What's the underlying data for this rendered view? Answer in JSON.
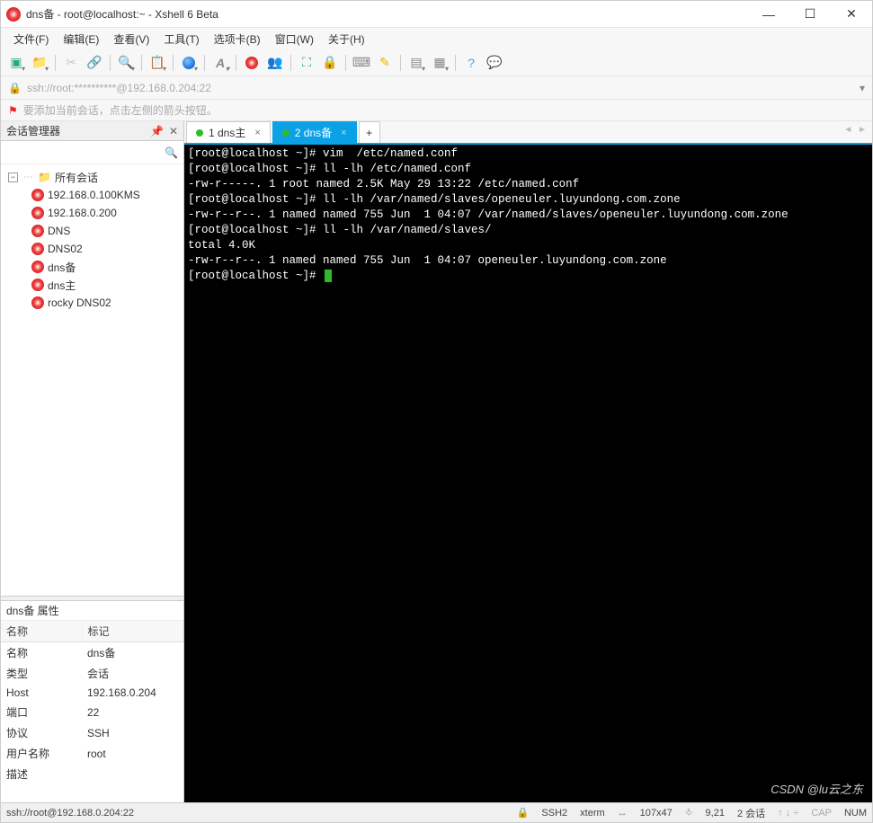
{
  "window": {
    "title": "dns备 - root@localhost:~ - Xshell 6 Beta",
    "min": "—",
    "max": "☐",
    "close": "✕"
  },
  "menu": {
    "file": "文件(F)",
    "edit": "编辑(E)",
    "view": "查看(V)",
    "tools": "工具(T)",
    "tabs": "选项卡(B)",
    "window": "窗口(W)",
    "help": "关于(H)"
  },
  "address": {
    "text": "ssh://root:**********@192.168.0.204:22"
  },
  "tip": {
    "text": "要添加当前会话，点击左侧的箭头按钮。"
  },
  "sidebar": {
    "title": "会话管理器",
    "root": "所有会话",
    "items": [
      {
        "label": "192.168.0.100KMS"
      },
      {
        "label": "192.168.0.200"
      },
      {
        "label": "DNS"
      },
      {
        "label": "DNS02"
      },
      {
        "label": "dns备"
      },
      {
        "label": "dns主"
      },
      {
        "label": "rocky DNS02"
      }
    ]
  },
  "properties": {
    "title": "dns备 属性",
    "col_name": "名称",
    "col_mark": "标记",
    "rows": [
      {
        "k": "名称",
        "v": "dns备"
      },
      {
        "k": "类型",
        "v": "会话"
      },
      {
        "k": "Host",
        "v": "192.168.0.204"
      },
      {
        "k": "端口",
        "v": "22"
      },
      {
        "k": "协议",
        "v": "SSH"
      },
      {
        "k": "用户名称",
        "v": "root"
      },
      {
        "k": "描述",
        "v": ""
      }
    ]
  },
  "tabs": {
    "t1": "1 dns主",
    "t2": "2 dns备",
    "add": "+"
  },
  "terminal": {
    "lines": [
      "[root@localhost ~]# vim  /etc/named.conf",
      "[root@localhost ~]# ll -lh /etc/named.conf",
      "-rw-r-----. 1 root named 2.5K May 29 13:22 /etc/named.conf",
      "[root@localhost ~]# ll -lh /var/named/slaves/openeuler.luyundong.com.zone",
      "-rw-r--r--. 1 named named 755 Jun  1 04:07 /var/named/slaves/openeuler.luyundong.com.zone",
      "[root@localhost ~]# ll -lh /var/named/slaves/",
      "total 4.0K",
      "-rw-r--r--. 1 named named 755 Jun  1 04:07 openeuler.luyundong.com.zone",
      "[root@localhost ~]# "
    ]
  },
  "status": {
    "conn": "ssh://root@192.168.0.204:22",
    "ssh": "SSH2",
    "term": "xterm",
    "size": "107x47",
    "pos": "9,21",
    "sess": "2 会话",
    "hint1": "",
    "caps": "CAP",
    "num": "NUM"
  },
  "watermark": "CSDN @lu云之东"
}
